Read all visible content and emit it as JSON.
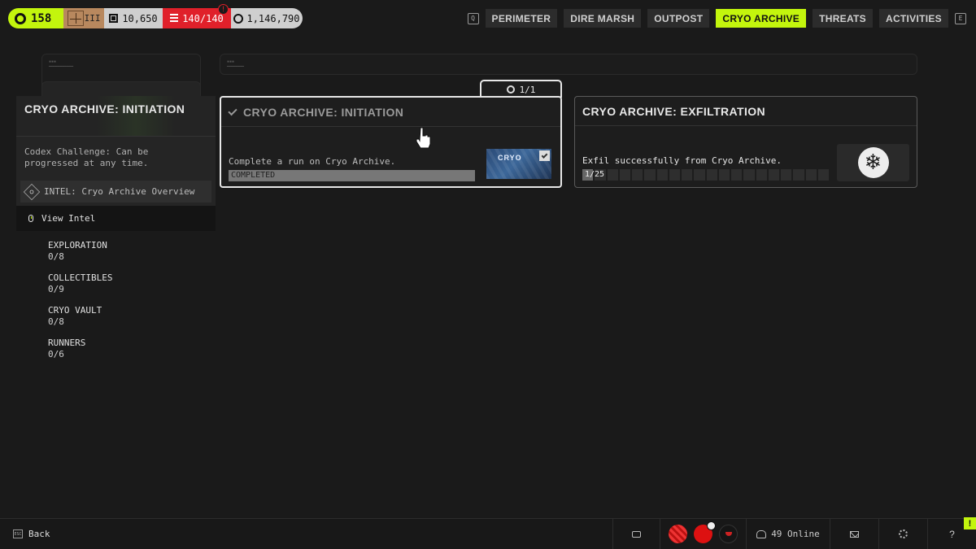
{
  "topbar": {
    "level": "158",
    "rank": "III",
    "credits": "10,650",
    "capacity": "140/140",
    "capacity_warning": "!",
    "coins": "1,146,790"
  },
  "tabs": {
    "prev_key": "Q",
    "next_key": "E",
    "items": [
      {
        "label": "PERIMETER",
        "active": false
      },
      {
        "label": "DIRE MARSH",
        "active": false
      },
      {
        "label": "OUTPOST",
        "active": false
      },
      {
        "label": "CRYO ARCHIVE",
        "active": true
      },
      {
        "label": "THREATS",
        "active": false
      },
      {
        "label": "ACTIVITIES",
        "active": false
      }
    ]
  },
  "info_panel": {
    "title": "CRYO ARCHIVE: INITIATION",
    "description": "Codex Challenge: Can be progressed at any time.",
    "intel_label": "INTEL: Cryo Archive Overview",
    "view_intel_label": "View Intel"
  },
  "categories": [
    {
      "name": "EXPLORATION",
      "value": "0/8"
    },
    {
      "name": "COLLECTIBLES",
      "value": "0/9"
    },
    {
      "name": "CRYO VAULT",
      "value": "0/8"
    },
    {
      "name": "RUNNERS",
      "value": "0/6"
    }
  ],
  "cards": {
    "count_label": "1/1",
    "initiation": {
      "title": "CRYO ARCHIVE: INITIATION",
      "description": "Complete a run on Cryo Archive.",
      "status": "COMPLETED",
      "reward_word": "CRYO",
      "completed": true
    },
    "exfiltration": {
      "title": "CRYO ARCHIVE: EXFILTRATION",
      "description": "Exfil successfully from Cryo Archive.",
      "progress": "1/25",
      "progress_current": 1,
      "progress_total": 25,
      "reward_icon": "snowflake-icon",
      "reward_glyph": "❄"
    }
  },
  "bottombar": {
    "back_key": "ESC",
    "back_label": "Back",
    "online": "49 Online",
    "help": "?",
    "notif": "!"
  },
  "colors": {
    "accent": "#c3f50d",
    "danger": "#e0202a",
    "background": "#1a1a1a"
  }
}
